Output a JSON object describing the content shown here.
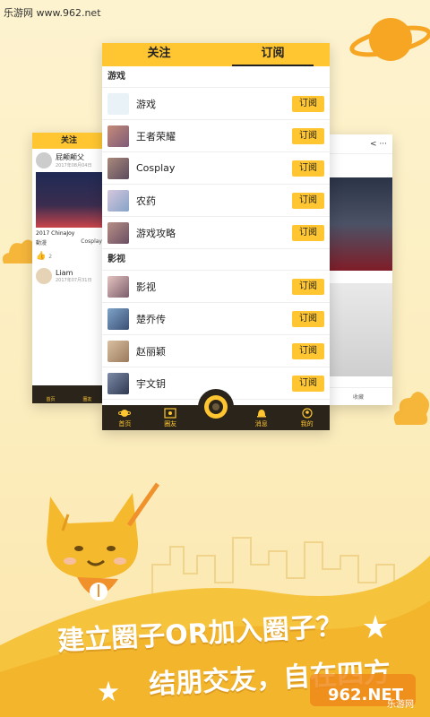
{
  "watermark": "乐游网 www.962.net",
  "main": {
    "tabs": [
      "关注",
      "订阅"
    ],
    "active_tab": 1,
    "sections": [
      {
        "title": "游戏",
        "items": [
          {
            "label": "游戏",
            "button": "订阅"
          },
          {
            "label": "王者荣耀",
            "button": "订阅"
          },
          {
            "label": "Cosplay",
            "button": "订阅"
          },
          {
            "label": "农药",
            "button": "订阅"
          },
          {
            "label": "游戏攻略",
            "button": "订阅"
          }
        ]
      },
      {
        "title": "影视",
        "items": [
          {
            "label": "影视",
            "button": "订阅"
          },
          {
            "label": "楚乔传",
            "button": "订阅"
          },
          {
            "label": "赵丽颖",
            "button": "订阅"
          },
          {
            "label": "宇文钥",
            "button": "订阅"
          }
        ]
      }
    ],
    "bottom_nav": [
      "首页",
      "圈友",
      "消息",
      "我的"
    ]
  },
  "left_phone": {
    "tab": "关注",
    "card1_user": "屁颠颠父",
    "card1_time": "2017年08月04日",
    "card1_caption": "2017 ChinaJoy",
    "card1_meta_a": "動漫",
    "card1_meta_b": "Cosplay",
    "card1_likes": "2",
    "card2_user": "Liam",
    "card2_time": "2017年07月31日",
    "nav": [
      "首页",
      "圈友"
    ]
  },
  "right_phone": {
    "top_icons": "< ···",
    "bottom_label": "收藏"
  },
  "slogan_line1": "建立圈子OR加入圈子？",
  "slogan_line2": "结朋交友，自在四方",
  "logo_text": "962.NET",
  "logo_sub": "乐游网",
  "colors": {
    "accent": "#ffc631",
    "dark_nav": "#2a241b",
    "background": "#fdf1c8",
    "planet": "#f6a623",
    "mascot": "#f5b92d"
  }
}
